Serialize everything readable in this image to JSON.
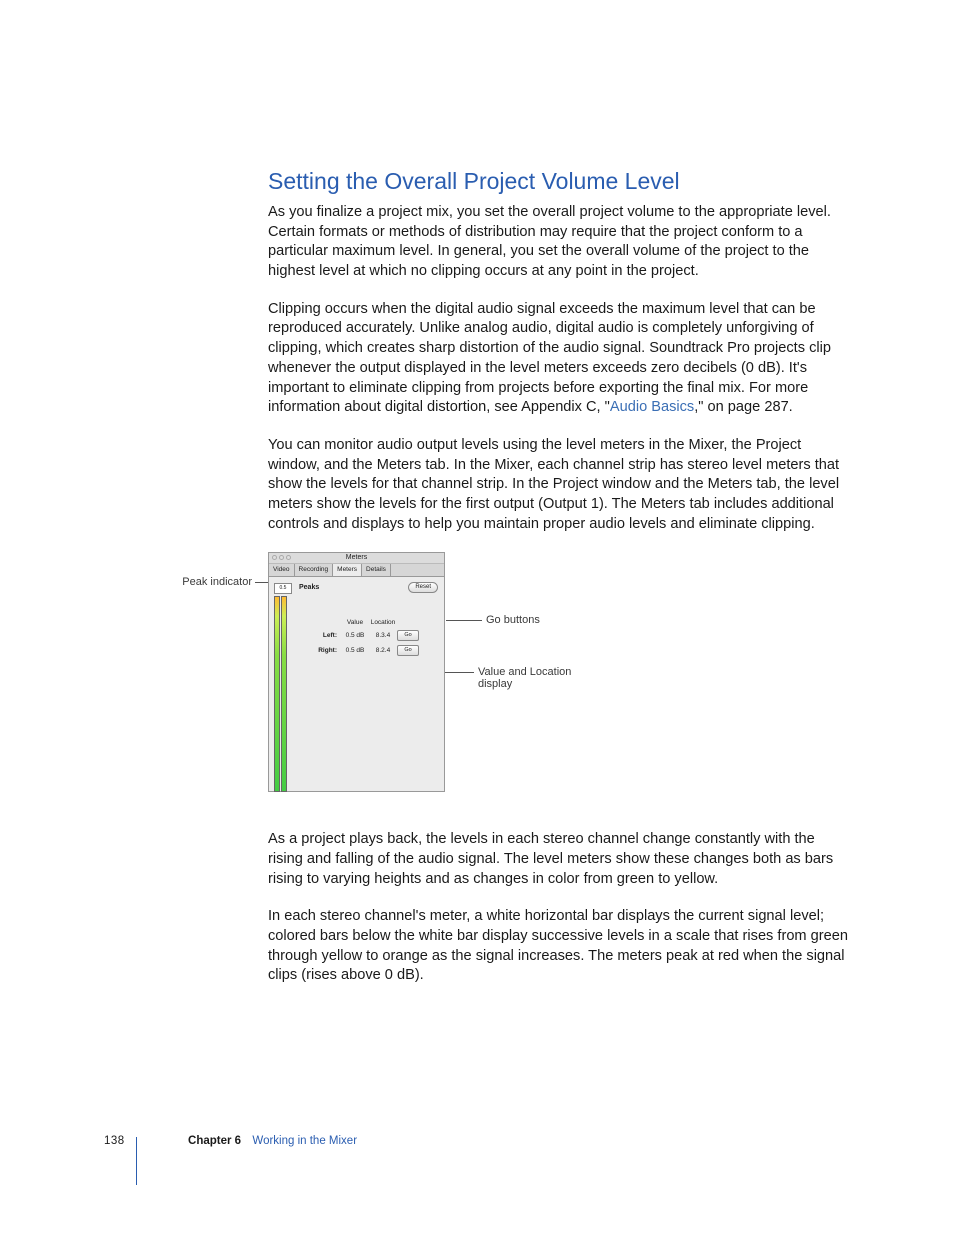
{
  "heading": "Setting the Overall Project Volume Level",
  "paragraphs": {
    "p1": "As you finalize a project mix, you set the overall project volume to the appropriate level. Certain formats or methods of distribution may require that the project conform to a particular maximum level. In general, you set the overall volume of the project to the highest level at which no clipping occurs at any point in the project.",
    "p2a": "Clipping occurs when the digital audio signal exceeds the maximum level that can be reproduced accurately. Unlike analog audio, digital audio is completely unforgiving of clipping, which creates sharp distortion of the audio signal. Soundtrack Pro projects clip whenever the output displayed in the level meters exceeds zero decibels (0 dB). It's important to eliminate clipping from projects before exporting the final mix. For more information about digital distortion, see Appendix C, \"",
    "p2link": "Audio Basics",
    "p2b": ",\" on page 287.",
    "p3": "You can monitor audio output levels using the level meters in the Mixer, the Project window, and the Meters tab. In the Mixer, each channel strip has stereo level meters that show the levels for that channel strip. In the Project window and the Meters tab, the level meters show the levels for the first output (Output 1). The Meters tab includes additional controls and displays to help you maintain proper audio levels and eliminate clipping.",
    "p4": "As a project plays back, the levels in each stereo channel change constantly with the rising and falling of the audio signal. The level meters show these changes both as bars rising to varying heights and as changes in color from green to yellow.",
    "p5": "In each stereo channel's meter, a white horizontal bar displays the current signal level; colored bars below the white bar display successive levels in a scale that rises from green through yellow to orange as the signal increases. The meters peak at red when the signal clips (rises above 0 dB)."
  },
  "callouts": {
    "peak_indicator": "Peak indicator",
    "go_buttons": "Go buttons",
    "value_location_display": "Value and Location display"
  },
  "panel": {
    "title": "Meters",
    "tabs": [
      "Video",
      "Recording",
      "Meters",
      "Details"
    ],
    "peaks_label": "Peaks",
    "reset": "Reset",
    "columns": {
      "value": "Value",
      "location": "Location"
    },
    "rows": {
      "left": {
        "label": "Left:",
        "value": "0.5 dB",
        "location": "8.3.4",
        "go": "Go"
      },
      "right": {
        "label": "Right:",
        "value": "0.5 dB",
        "location": "8.2.4",
        "go": "Go"
      }
    },
    "peak_indicator_small": "0.5"
  },
  "footer": {
    "page": "138",
    "chapter_label": "Chapter 6",
    "chapter_title": "Working in the Mixer"
  }
}
